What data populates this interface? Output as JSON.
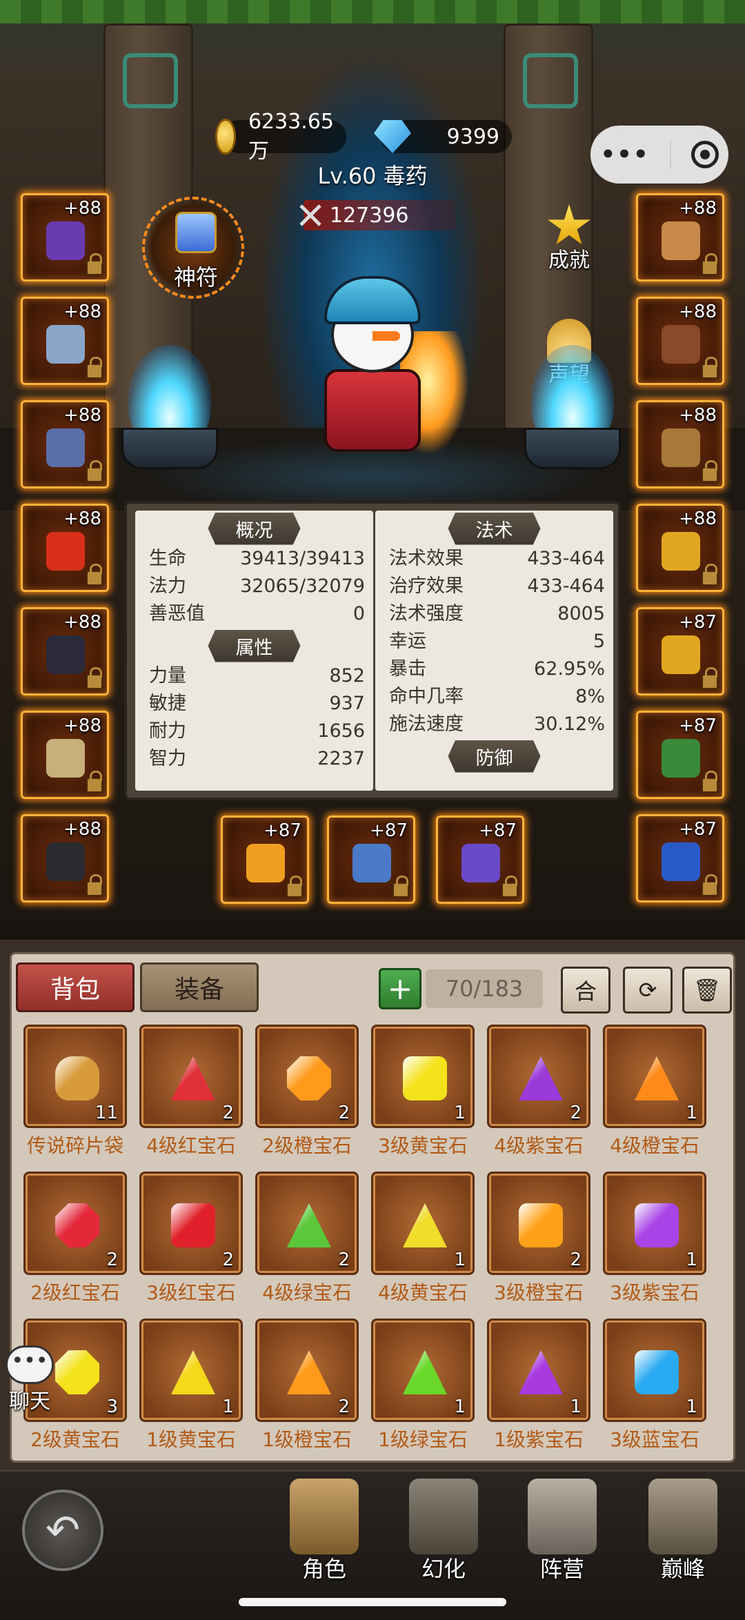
{
  "header": {
    "gold": "6233.65万",
    "diamonds": "9399",
    "level_name": "Lv.60 毒药",
    "power": "127396"
  },
  "capsule": {
    "more": "•••"
  },
  "side": {
    "amulet": "神符",
    "achievement": "成就",
    "reputation": "声望"
  },
  "slots": {
    "left": [
      "+88",
      "+88",
      "+88",
      "+88",
      "+88",
      "+88",
      "+88"
    ],
    "right": [
      "+88",
      "+88",
      "+88",
      "+88",
      "+87",
      "+87",
      "+87"
    ],
    "bottom": [
      "+87",
      "+87",
      "+87"
    ]
  },
  "stats": {
    "overview_title": "概况",
    "overview": [
      {
        "label": "生命",
        "value": "39413/39413"
      },
      {
        "label": "法力",
        "value": "32065/32079"
      },
      {
        "label": "善恶值",
        "value": "0"
      }
    ],
    "attr_title": "属性",
    "attributes": [
      {
        "label": "力量",
        "value": "852"
      },
      {
        "label": "敏捷",
        "value": "937"
      },
      {
        "label": "耐力",
        "value": "1656"
      },
      {
        "label": "智力",
        "value": "2237"
      }
    ],
    "spell_title": "法术",
    "spells": [
      {
        "label": "法术效果",
        "value": "433-464"
      },
      {
        "label": "治疗效果",
        "value": "433-464"
      },
      {
        "label": "法术强度",
        "value": "8005"
      },
      {
        "label": "幸运",
        "value": "5"
      },
      {
        "label": "暴击",
        "value": "62.95%"
      },
      {
        "label": "命中几率",
        "value": "8%"
      },
      {
        "label": "施法速度",
        "value": "30.12%"
      }
    ],
    "defense_title": "防御"
  },
  "bag": {
    "tab_bag": "背包",
    "tab_equip": "装备",
    "add": "+",
    "capacity": "70/183",
    "merge": "合",
    "refresh": "⟳",
    "delete": "🗑",
    "items": [
      {
        "name": "传说碎片袋",
        "qty": "11",
        "color": "#d89a3a",
        "shape": "bag-ico"
      },
      {
        "name": "4级红宝石",
        "qty": "2",
        "color": "#e0303a",
        "shape": "tri"
      },
      {
        "name": "2级橙宝石",
        "qty": "2",
        "color": "#ff9a1a",
        "shape": "round"
      },
      {
        "name": "3级黄宝石",
        "qty": "1",
        "color": "#f4e21a",
        "shape": "sq"
      },
      {
        "name": "4级紫宝石",
        "qty": "2",
        "color": "#9a3ad8",
        "shape": "tri"
      },
      {
        "name": "4级橙宝石",
        "qty": "1",
        "color": "#ff8a1a",
        "shape": "tri"
      },
      {
        "name": "2级红宝石",
        "qty": "2",
        "color": "#e4283a",
        "shape": "round"
      },
      {
        "name": "3级红宝石",
        "qty": "2",
        "color": "#e0202a",
        "shape": "sq"
      },
      {
        "name": "4级绿宝石",
        "qty": "2",
        "color": "#5ac83a",
        "shape": "tri"
      },
      {
        "name": "4级黄宝石",
        "qty": "1",
        "color": "#f0dc2a",
        "shape": "tri"
      },
      {
        "name": "3级橙宝石",
        "qty": "2",
        "color": "#ffa21a",
        "shape": "sq"
      },
      {
        "name": "3级紫宝石",
        "qty": "1",
        "color": "#a844e8",
        "shape": "sq"
      },
      {
        "name": "2级黄宝石",
        "qty": "3",
        "color": "#f4e21a",
        "shape": "round"
      },
      {
        "name": "1级黄宝石",
        "qty": "1",
        "color": "#f4d81a",
        "shape": "tri"
      },
      {
        "name": "1级橙宝石",
        "qty": "2",
        "color": "#ff9a1a",
        "shape": "tri"
      },
      {
        "name": "1级绿宝石",
        "qty": "1",
        "color": "#6ad82a",
        "shape": "tri"
      },
      {
        "name": "1级紫宝石",
        "qty": "1",
        "color": "#a83ae0",
        "shape": "tri"
      },
      {
        "name": "3级蓝宝石",
        "qty": "1",
        "color": "#2aaaf0",
        "shape": "sq"
      }
    ]
  },
  "chat": {
    "label": "聊天",
    "bubble": "•••"
  },
  "nav": {
    "back": "↶",
    "items": [
      {
        "label": "角色"
      },
      {
        "label": "幻化"
      },
      {
        "label": "阵营"
      },
      {
        "label": "巅峰"
      }
    ]
  }
}
